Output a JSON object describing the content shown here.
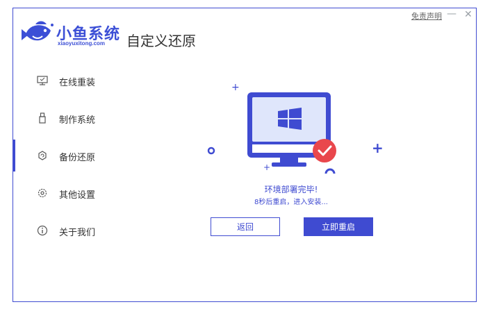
{
  "app": {
    "name": "小鱼系统",
    "url": "xiaoyuxitong.com",
    "page_title": "自定义还原",
    "disclaimer": "免责声明",
    "minimize": "—",
    "close": "✕"
  },
  "sidebar": {
    "items": [
      {
        "label": "在线重装",
        "icon": "monitor-icon"
      },
      {
        "label": "制作系统",
        "icon": "usb-icon"
      },
      {
        "label": "备份还原",
        "icon": "backup-icon",
        "active": true
      },
      {
        "label": "其他设置",
        "icon": "gear-icon"
      },
      {
        "label": "关于我们",
        "icon": "info-icon"
      }
    ]
  },
  "main": {
    "status_title": "环境部署完毕!",
    "status_sub": "8秒后重启，进入安装...",
    "back_label": "返回",
    "restart_label": "立即重启"
  },
  "colors": {
    "accent": "#3f4bd1",
    "check_badge": "#e9474c",
    "screen_bg": "#dfe6fb"
  }
}
